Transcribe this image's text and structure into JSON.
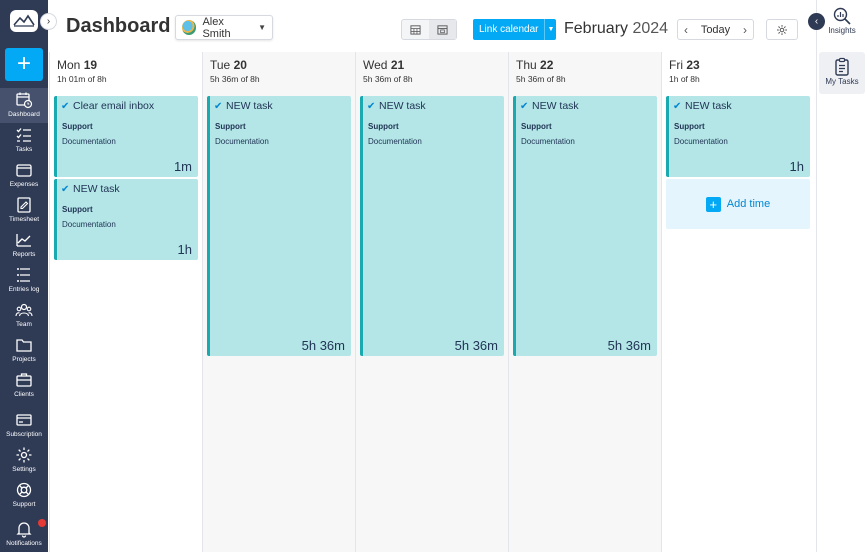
{
  "app": {
    "brand_color": "#2f3a55",
    "accent_color": "#03a9f4",
    "task_color": "#b4e6e8"
  },
  "sidebar": {
    "items": [
      {
        "label": "Dashboard",
        "icon": "calendar-clock-icon",
        "active": true
      },
      {
        "label": "Tasks",
        "icon": "checklist-icon"
      },
      {
        "label": "Expenses",
        "icon": "wallet-icon"
      },
      {
        "label": "Timesheet",
        "icon": "timesheet-icon"
      },
      {
        "label": "Reports",
        "icon": "chart-line-icon"
      },
      {
        "label": "Entries log",
        "icon": "entries-log-icon"
      },
      {
        "label": "Team",
        "icon": "team-icon"
      },
      {
        "label": "Projects",
        "icon": "folder-icon"
      },
      {
        "label": "Clients",
        "icon": "briefcase-icon"
      },
      {
        "label": "Subscription",
        "icon": "credit-card-icon"
      },
      {
        "label": "Settings",
        "icon": "gear-icon"
      },
      {
        "label": "Support",
        "icon": "lifebuoy-icon"
      },
      {
        "label": "Notifications",
        "icon": "bell-icon"
      }
    ]
  },
  "header": {
    "title": "Dashboard",
    "user": "Alex Smith",
    "link_calendar": "Link calendar",
    "month": "February",
    "year": "2024",
    "today": "Today"
  },
  "right_panel": {
    "items": [
      {
        "label": "Insights"
      },
      {
        "label": "My Tasks"
      }
    ]
  },
  "days": [
    {
      "name": "Mon",
      "num": "19",
      "summary": "1h 01m of 8h",
      "tasks": [
        {
          "title": "Clear email inbox",
          "project": "Support",
          "subtitle": "Documentation",
          "duration": "1m"
        },
        {
          "title": "NEW task",
          "project": "Support",
          "subtitle": "Documentation",
          "duration": "1h"
        }
      ]
    },
    {
      "name": "Tue",
      "num": "20",
      "summary": "5h 36m of 8h",
      "tasks": [
        {
          "title": "NEW task",
          "project": "Support",
          "subtitle": "Documentation",
          "duration": "5h 36m"
        }
      ]
    },
    {
      "name": "Wed",
      "num": "21",
      "summary": "5h 36m of 8h",
      "tasks": [
        {
          "title": "NEW task",
          "project": "Support",
          "subtitle": "Documentation",
          "duration": "5h 36m"
        }
      ]
    },
    {
      "name": "Thu",
      "num": "22",
      "summary": "5h 36m of 8h",
      "tasks": [
        {
          "title": "NEW task",
          "project": "Support",
          "subtitle": "Documentation",
          "duration": "5h 36m"
        }
      ]
    },
    {
      "name": "Fri",
      "num": "23",
      "summary": "1h of 8h",
      "tasks": [
        {
          "title": "NEW task",
          "project": "Support",
          "subtitle": "Documentation",
          "duration": "1h"
        }
      ],
      "add_time": "Add time"
    }
  ]
}
